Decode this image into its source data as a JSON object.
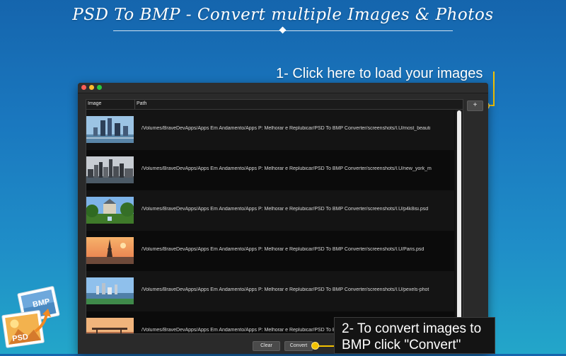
{
  "hero": {
    "title": "PSD To BMP - Convert multiple Images & Photos"
  },
  "callouts": {
    "load_images": "1- Click here to load your images",
    "convert_line1": "2- To convert images to",
    "convert_line2": "BMP click \"Convert\""
  },
  "window": {
    "table": {
      "columns": [
        "Image",
        "Path"
      ],
      "rows": [
        {
          "thumbnail": "city-skyscrapers-photo",
          "path": "/Volumes/BraveDevApps/Apps Em Andamento/Apps P: Melhorar e Replubicar/PSD To BMP Converter/screenshots/I.U/most_beauti"
        },
        {
          "thumbnail": "new-york-skyline-photo",
          "path": "/Volumes/BraveDevApps/Apps Em Andamento/Apps P: Melhorar e Replubicar/PSD To BMP Converter/screenshots/I.U/new_york_m"
        },
        {
          "thumbnail": "castle-garden-photo",
          "path": "/Volumes/BraveDevApps/Apps Em Andamento/Apps P: Melhorar e Replubicar/PSD To BMP Converter/screenshots/I.U/p4k8isi.psd"
        },
        {
          "thumbnail": "eiffel-tower-photo",
          "path": "/Volumes/BraveDevApps/Apps Em Andamento/Apps P: Melhorar e Replubicar/PSD To BMP Converter/screenshots/I.U/Paris.psd"
        },
        {
          "thumbnail": "coastal-city-photo",
          "path": "/Volumes/BraveDevApps/Apps Em Andamento/Apps P: Melhorar e Replubicar/PSD To BMP Converter/screenshots/I.U/pexels-phot"
        },
        {
          "thumbnail": "bridge-sunset-photo",
          "path": "/Volumes/BraveDevApps/Apps Em Andamento/Apps P: Melhorar e Replubicar/PSD To BMP Converter/screenshots/I.U/pexels-phot"
        }
      ]
    },
    "add_button": "+",
    "clear_button": "Clear",
    "convert_button": "Convert"
  },
  "app_icon": {
    "name": "psd-to-bmp-app-icon",
    "labels": [
      "BMP",
      "PSD"
    ]
  },
  "colors": {
    "accent": "#f3c200",
    "background_top": "#1565ad",
    "background_bottom": "#23a6c9",
    "window": "#2a2a2a"
  }
}
